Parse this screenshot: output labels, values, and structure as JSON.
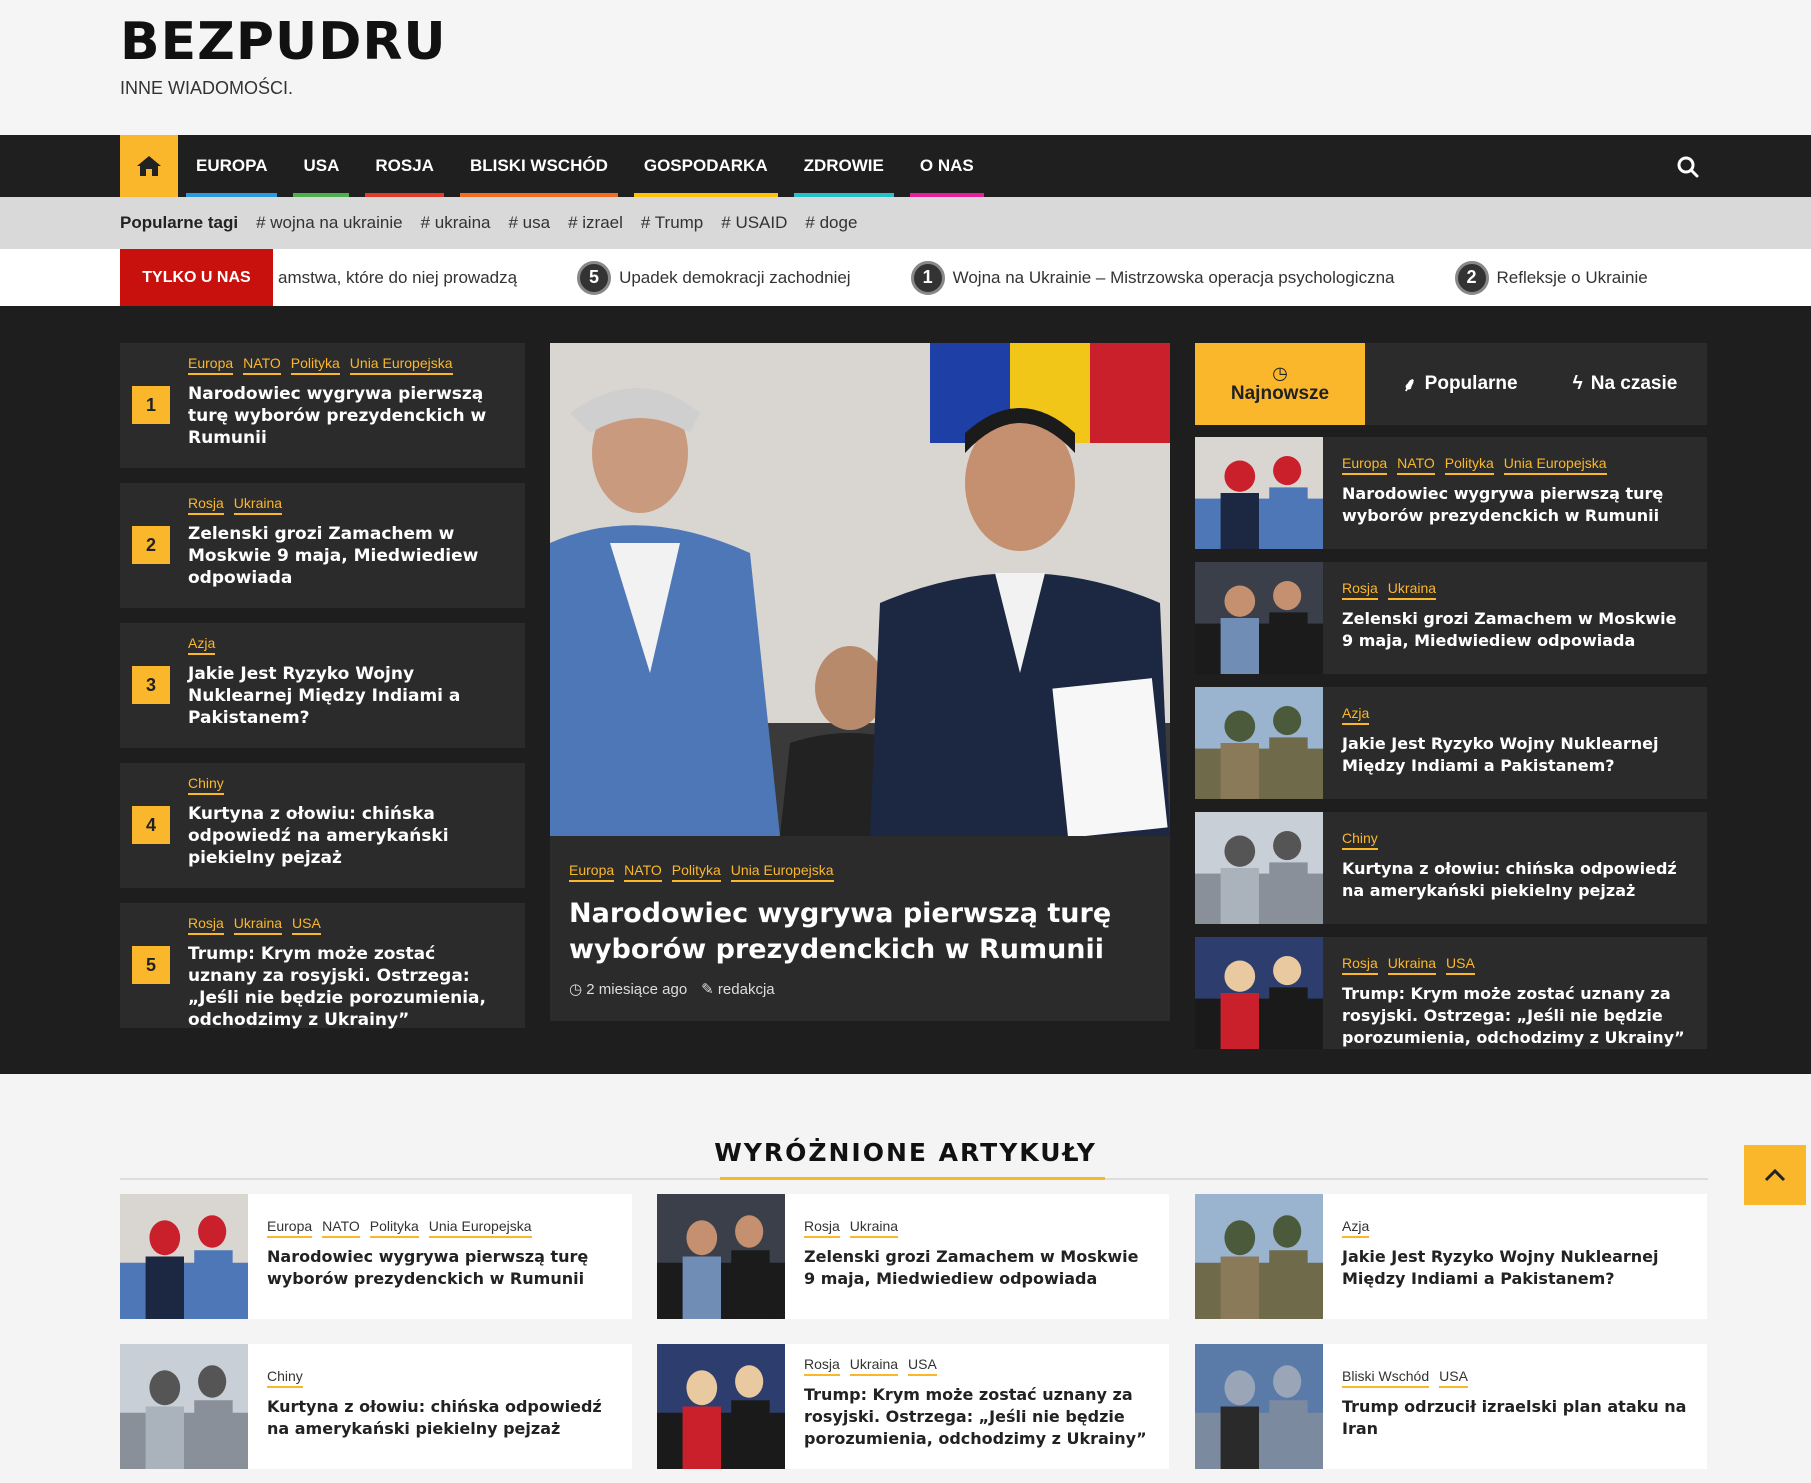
{
  "header": {
    "logo": "BEZPUDRU",
    "tagline": "INNE WIADOMOŚCI."
  },
  "nav": {
    "home_icon": "home-icon",
    "items": [
      {
        "label": "EUROPA",
        "color": "#2b9be0"
      },
      {
        "label": "USA",
        "color": "#4caf50"
      },
      {
        "label": "ROSJA",
        "color": "#e23b2a"
      },
      {
        "label": "BLISKI WSCHÓD",
        "color": "#f36c21"
      },
      {
        "label": "GOSPODARKA",
        "color": "#ffc107"
      },
      {
        "label": "ZDROWIE",
        "color": "#24c1c9"
      },
      {
        "label": "O NAS",
        "color": "#e91e9b"
      }
    ],
    "search_icon": "search-icon"
  },
  "tags": {
    "title": "Popularne tagi",
    "items": [
      "# wojna na ukrainie",
      "# ukraina",
      "# usa",
      "# izrael",
      "# Trump",
      "# USAID",
      "# doge"
    ]
  },
  "ticker": {
    "label": "TYLKO U NAS",
    "items": [
      {
        "num": "",
        "text": "amstwa, które do niej prowadzą"
      },
      {
        "num": "5",
        "text": "Upadek demokracji zachodniej"
      },
      {
        "num": "1",
        "text": "Wojna na Ukrainie – Mistrzowska operacja psychologiczna"
      },
      {
        "num": "2",
        "text": "Refleksje o Ukrainie"
      }
    ]
  },
  "ranked": [
    {
      "num": "1",
      "cats": [
        "Europa",
        "NATO",
        "Polityka",
        "Unia Europejska"
      ],
      "title": "Narodowiec wygrywa pierwszą turę wyborów prezydenckich w Rumunii"
    },
    {
      "num": "2",
      "cats": [
        "Rosja",
        "Ukraina"
      ],
      "title": "Zelenski grozi Zamachem w Moskwie 9 maja, Miedwiediew odpowiada"
    },
    {
      "num": "3",
      "cats": [
        "Azja"
      ],
      "title": "Jakie Jest Ryzyko Wojny Nuklearnej Między Indiami a Pakistanem?"
    },
    {
      "num": "4",
      "cats": [
        "Chiny"
      ],
      "title": "Kurtyna z ołowiu: chińska odpowiedź na amerykański piekielny pejzaż"
    },
    {
      "num": "5",
      "cats": [
        "Rosja",
        "Ukraina",
        "USA"
      ],
      "title": "Trump: Krym może zostać uznany za rosyjski. Ostrzega: „Jeśli nie będzie porozumienia, odchodzimy z Ukrainy”"
    }
  ],
  "feature": {
    "cats": [
      "Europa",
      "NATO",
      "Polityka",
      "Unia Europejska"
    ],
    "title": "Narodowiec wygrywa pierwszą turę wyborów prezydenckich w Rumunii",
    "time": "2 miesiące ago",
    "author": "redakcja"
  },
  "tabs": [
    {
      "label": "Najnowsze",
      "icon": "clock-icon"
    },
    {
      "label": "Popularne",
      "icon": "flame-icon"
    },
    {
      "label": "Na czasie",
      "icon": "bolt-icon"
    }
  ],
  "side": [
    {
      "cats": [
        "Europa",
        "NATO",
        "Polityka",
        "Unia Europejska"
      ],
      "title": "Narodowiec wygrywa pierwszą turę wyborów prezydenckich w Rumunii"
    },
    {
      "cats": [
        "Rosja",
        "Ukraina"
      ],
      "title": "Zelenski grozi Zamachem w Moskwie 9 maja, Miedwiediew odpowiada"
    },
    {
      "cats": [
        "Azja"
      ],
      "title": "Jakie Jest Ryzyko Wojny Nuklearnej Między Indiami a Pakistanem?"
    },
    {
      "cats": [
        "Chiny"
      ],
      "title": "Kurtyna z ołowiu: chińska odpowiedź na amerykański piekielny pejzaż"
    },
    {
      "cats": [
        "Rosja",
        "Ukraina",
        "USA"
      ],
      "title": "Trump: Krym może zostać uznany za rosyjski. Ostrzega: „Jeśli nie będzie porozumienia, odchodzimy z Ukrainy”"
    }
  ],
  "featured": {
    "heading": "WYRÓŻNIONE ARTYKUŁY",
    "items": [
      {
        "cats": [
          "Europa",
          "NATO",
          "Polityka",
          "Unia Europejska"
        ],
        "title": "Narodowiec wygrywa pierwszą turę wyborów prezydenckich w Rumunii"
      },
      {
        "cats": [
          "Rosja",
          "Ukraina"
        ],
        "title": "Zelenski grozi Zamachem w Moskwie 9 maja, Miedwiediew odpowiada"
      },
      {
        "cats": [
          "Azja"
        ],
        "title": "Jakie Jest Ryzyko Wojny Nuklearnej Między Indiami a Pakistanem?"
      },
      {
        "cats": [
          "Chiny"
        ],
        "title": "Kurtyna z ołowiu: chińska odpowiedź na amerykański piekielny pejzaż"
      },
      {
        "cats": [
          "Rosja",
          "Ukraina",
          "USA"
        ],
        "title": "Trump: Krym może zostać uznany za rosyjski. Ostrzega: „Jeśli nie będzie porozumienia, odchodzimy z Ukrainy”"
      },
      {
        "cats": [
          "Bliski Wschód",
          "USA"
        ],
        "title": "Trump odrzucił izraelski plan ataku na Iran"
      }
    ]
  },
  "colors": {
    "accent": "#fbb72b",
    "exclusive": "#c8100d",
    "dark_bg": "#1e1e1e",
    "card_bg": "#2b2b2b"
  }
}
